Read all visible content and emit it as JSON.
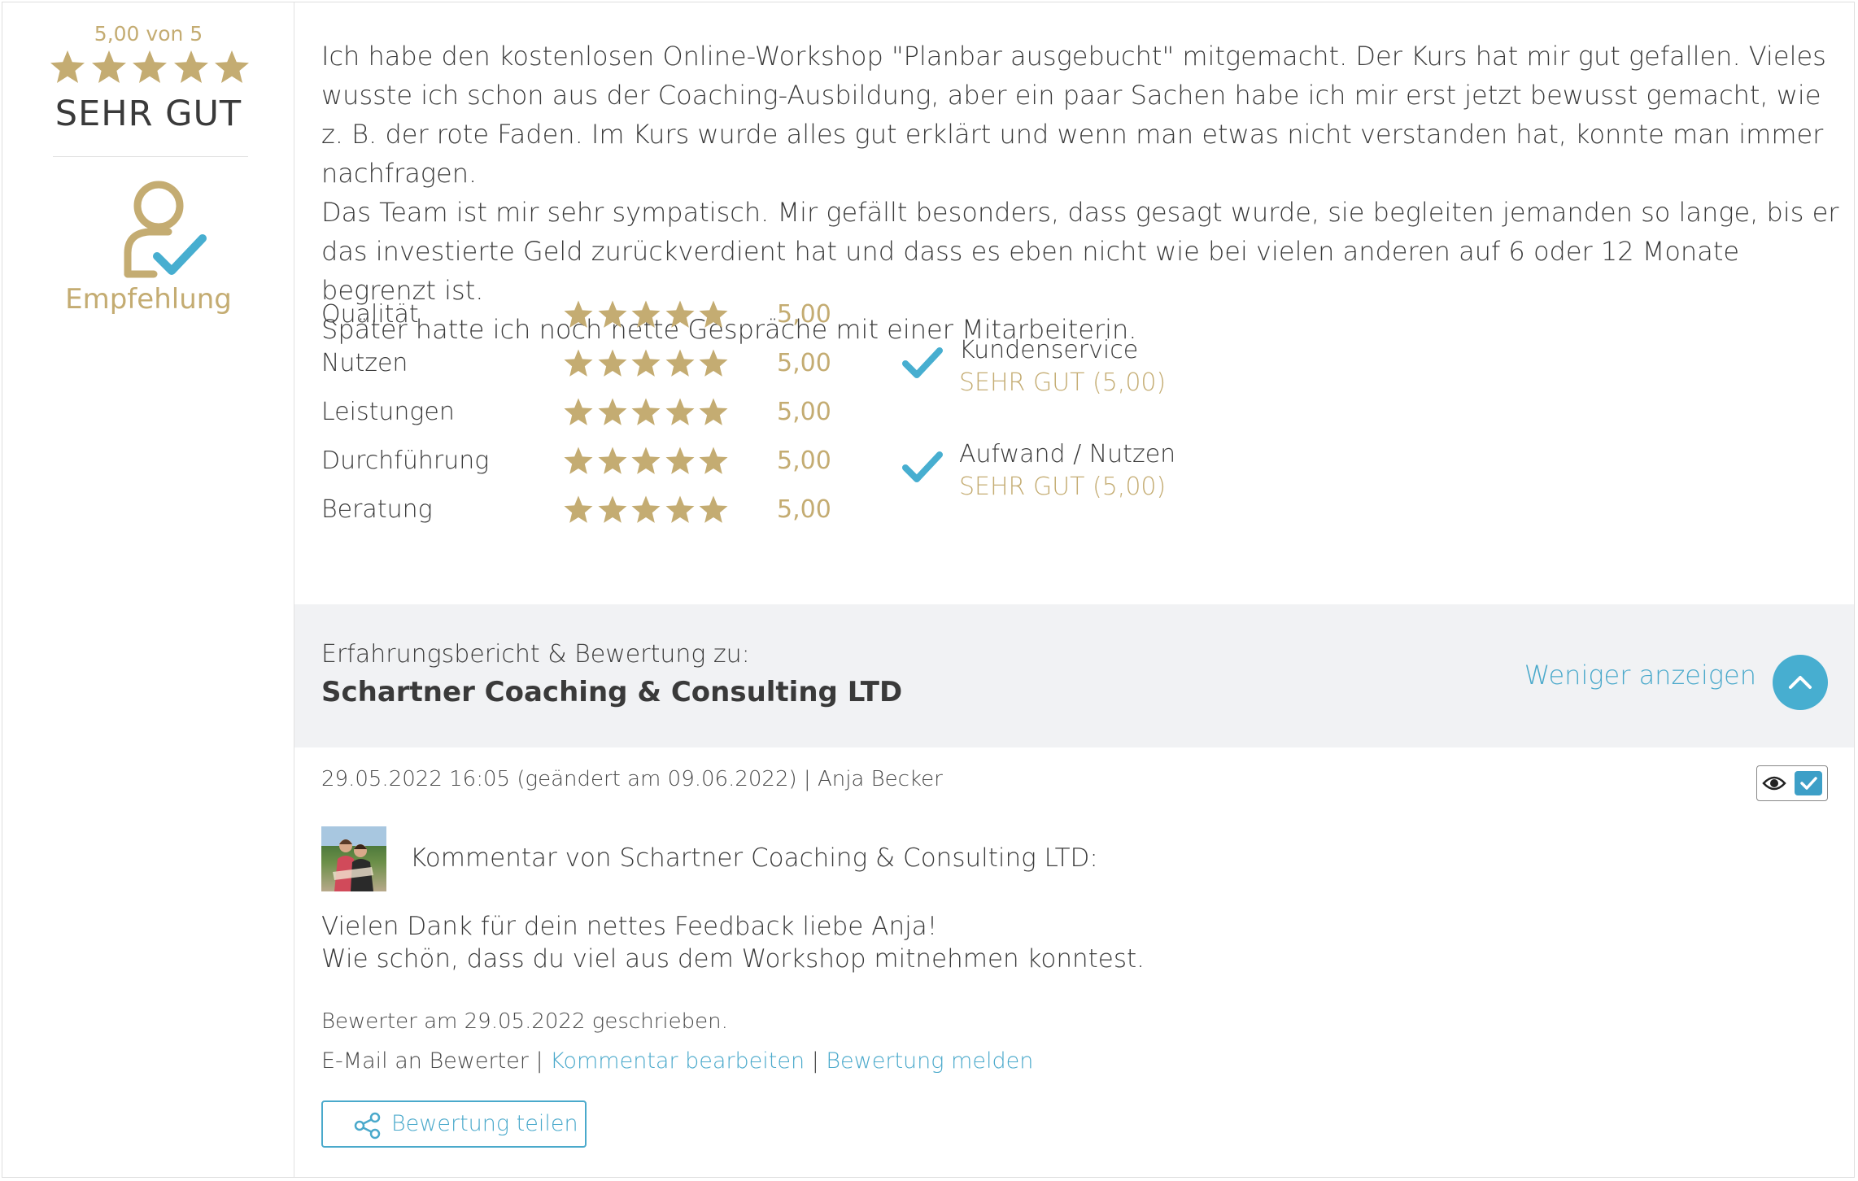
{
  "colors": {
    "gold": "#c4ac72",
    "accent_blue": "#4aa9cb",
    "check_blue": "#47aed0",
    "gray_panel": "#f1f2f4"
  },
  "summary": {
    "score_text": "5,00 von 5",
    "stars": 5,
    "grade": "SEHR GUT",
    "recommendation_icon": "user-check-icon",
    "recommendation_label": "Empfehlung"
  },
  "review": {
    "paragraphs": [
      "Ich habe den kostenlosen Online-Workshop \"Planbar ausgebucht\" mitgemacht. Der Kurs hat mir gut gefallen. Vieles wusste ich schon aus der Coaching-Ausbildung, aber ein paar Sachen habe ich mir erst jetzt bewusst gemacht, wie z. B. der rote Faden. Im Kurs wurde alles gut erklärt und wenn man etwas nicht verstanden hat, konnte man immer nachfragen.",
      "Das Team ist mir sehr sympatisch. Mir gefällt besonders, dass gesagt wurde, sie begleiten jemanden so lange, bis er das investierte Geld zurückverdient hat und dass es eben nicht wie bei vielen anderen auf 6 oder 12 Monate begrenzt ist.",
      "Später hatte ich noch nette Gespräche mit einer Mitarbeiterin."
    ]
  },
  "ratings": [
    {
      "label": "Qualität",
      "stars": 5,
      "value": "5,00"
    },
    {
      "label": "Nutzen",
      "stars": 5,
      "value": "5,00"
    },
    {
      "label": "Leistungen",
      "stars": 5,
      "value": "5,00"
    },
    {
      "label": "Durchführung",
      "stars": 5,
      "value": "5,00"
    },
    {
      "label": "Beratung",
      "stars": 5,
      "value": "5,00"
    }
  ],
  "checks": [
    {
      "label": "Kundenservice",
      "result": "SEHR GUT (5,00)",
      "icon": "checkmark-icon"
    },
    {
      "label": "Aufwand / Nutzen",
      "result": "SEHR GUT (5,00)",
      "icon": "checkmark-icon"
    }
  ],
  "about": {
    "intro": "Erfahrungsbericht & Bewertung zu:",
    "company": "Schartner Coaching & Consulting LTD",
    "less_label": "Weniger anzeigen",
    "less_icon": "chevron-up-icon"
  },
  "meta": {
    "line": "29.05.2022 16:05 (geändert am 09.06.2022) | Anja Becker",
    "tool_icons": [
      "eye-icon",
      "checkbox-checked-icon"
    ]
  },
  "comment": {
    "heading": "Kommentar von Schartner Coaching & Consulting LTD:",
    "lines": [
      "Vielen Dank für dein nettes Feedback liebe Anja!",
      "Wie schön, dass du viel aus dem Workshop mitnehmen konntest."
    ]
  },
  "footer": {
    "written": "Bewerter am 29.05.2022 geschrieben.",
    "email_label": "E-Mail an Bewerter",
    "separator": " | ",
    "edit_label": "Kommentar bearbeiten",
    "report_label": "Bewertung melden",
    "share_label": "Bewertung teilen",
    "share_icon": "share-icon"
  }
}
